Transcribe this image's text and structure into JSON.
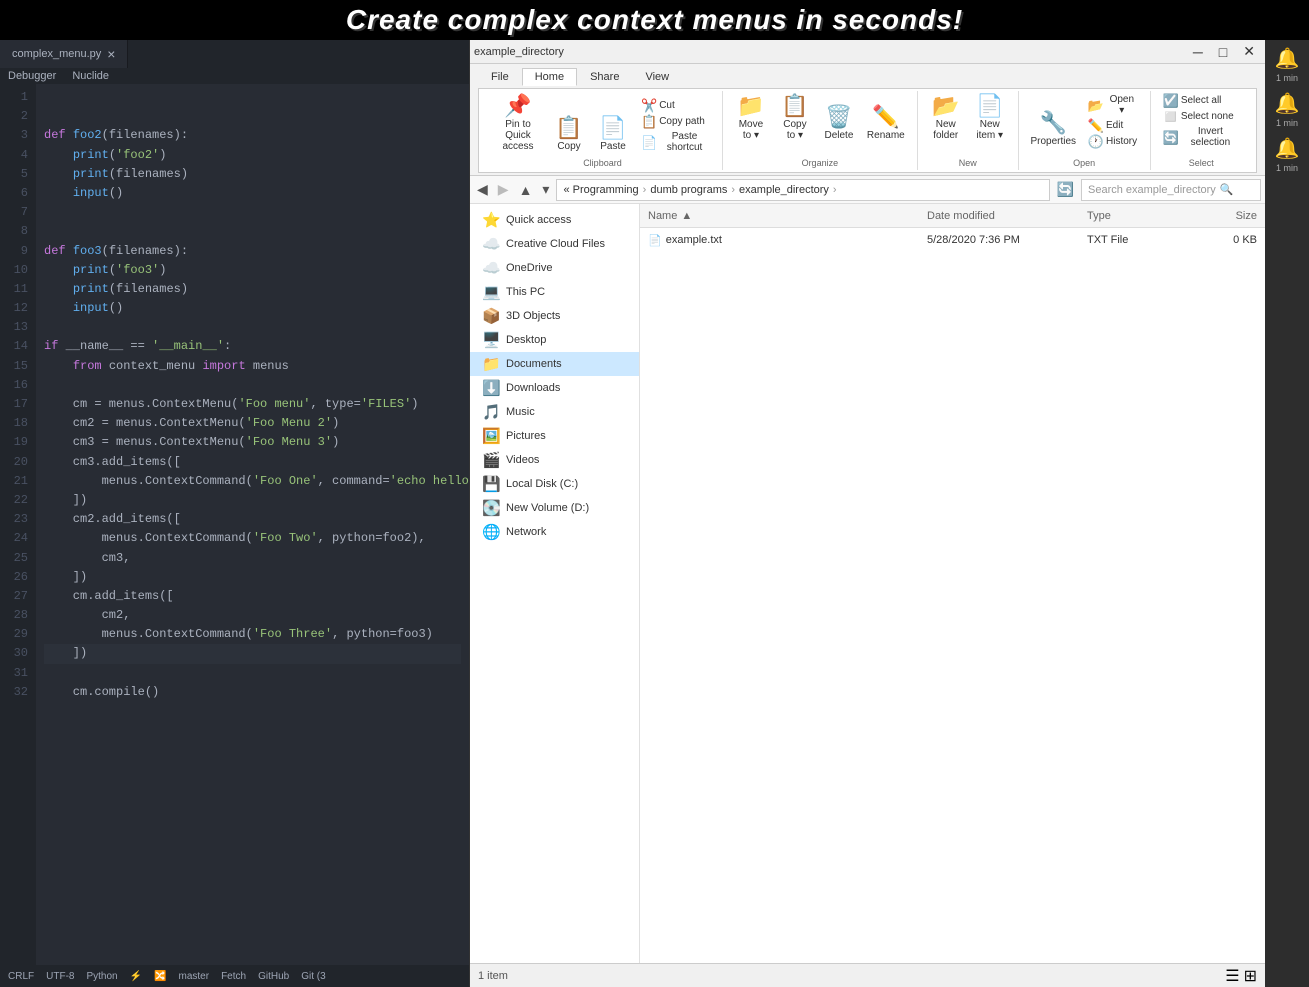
{
  "banner": {
    "text": "Create complex context menus in seconds!"
  },
  "editor": {
    "tab_name": "complex_menu.py",
    "menu_items": [
      "Debugger",
      "Nuclide"
    ],
    "code_lines": [
      {
        "num": 1,
        "text": ""
      },
      {
        "num": 2,
        "text": ""
      },
      {
        "num": 3,
        "text": "def foo2(filenames):"
      },
      {
        "num": 4,
        "text": "    print('foo2')"
      },
      {
        "num": 5,
        "text": "    print(filenames)"
      },
      {
        "num": 6,
        "text": "    input()"
      },
      {
        "num": 7,
        "text": ""
      },
      {
        "num": 8,
        "text": ""
      },
      {
        "num": 9,
        "text": "def foo3(filenames):"
      },
      {
        "num": 10,
        "text": "    print('foo3')"
      },
      {
        "num": 11,
        "text": "    print(filenames)"
      },
      {
        "num": 12,
        "text": "    input()"
      },
      {
        "num": 13,
        "text": ""
      },
      {
        "num": 14,
        "text": "if __name__ == '__main__':"
      },
      {
        "num": 15,
        "text": "    from context_menu import menus"
      },
      {
        "num": 16,
        "text": ""
      },
      {
        "num": 17,
        "text": "    cm = menus.ContextMenu('Foo menu', type='FILES')"
      },
      {
        "num": 18,
        "text": "    cm2 = menus.ContextMenu('Foo Menu 2')"
      },
      {
        "num": 19,
        "text": "    cm3 = menus.ContextMenu('Foo Menu 3')"
      },
      {
        "num": 20,
        "text": "    cm3.add_items(["
      },
      {
        "num": 21,
        "text": "        menus.ContextCommand('Foo One', command='echo hello > example.txt'),"
      },
      {
        "num": 22,
        "text": "    ])"
      },
      {
        "num": 23,
        "text": "    cm2.add_items(["
      },
      {
        "num": 24,
        "text": "        menus.ContextCommand('Foo Two', python=foo2),"
      },
      {
        "num": 25,
        "text": "        cm3,"
      },
      {
        "num": 26,
        "text": "    ])"
      },
      {
        "num": 27,
        "text": "    cm.add_items(["
      },
      {
        "num": 28,
        "text": "        cm2,"
      },
      {
        "num": 29,
        "text": "        menus.ContextCommand('Foo Three', python=foo3)"
      },
      {
        "num": 30,
        "text": "    ])"
      },
      {
        "num": 31,
        "text": "    cm.compile()"
      },
      {
        "num": 32,
        "text": ""
      }
    ],
    "statusbar": {
      "crlf": "CRLF",
      "encoding": "UTF-8",
      "language": "Python",
      "branch": "master",
      "fetch": "Fetch",
      "github": "GitHub",
      "git": "Git (3"
    }
  },
  "explorer": {
    "title": "example_directory",
    "ribbon": {
      "tabs": [
        "File",
        "Home",
        "Share",
        "View"
      ],
      "active_tab": "Home",
      "groups": [
        {
          "name": "Clipboard",
          "items": [
            {
              "label": "Pin to Quick\naccess",
              "icon": "📌",
              "type": "large"
            },
            {
              "label": "Copy",
              "icon": "📋",
              "type": "large"
            },
            {
              "label": "Paste",
              "icon": "📄",
              "type": "large"
            },
            {
              "label": "Cut",
              "icon": "✂️",
              "type": "small"
            },
            {
              "label": "Copy path",
              "icon": "📋",
              "type": "small"
            },
            {
              "label": "Paste shortcut",
              "icon": "📄",
              "type": "small"
            }
          ]
        },
        {
          "name": "Organize",
          "items": [
            {
              "label": "Move to",
              "icon": "📁",
              "type": "large"
            },
            {
              "label": "Copy to",
              "icon": "📋",
              "type": "large"
            },
            {
              "label": "Delete",
              "icon": "🗑️",
              "type": "large"
            },
            {
              "label": "Rename",
              "icon": "✏️",
              "type": "large"
            }
          ]
        },
        {
          "name": "New",
          "items": [
            {
              "label": "New\nfolder",
              "icon": "📂",
              "type": "large"
            },
            {
              "label": "New\nitem",
              "icon": "📄",
              "type": "large"
            }
          ]
        },
        {
          "name": "Open",
          "items": [
            {
              "label": "Properties",
              "icon": "🔧",
              "type": "large"
            },
            {
              "label": "Open",
              "icon": "📂",
              "type": "small",
              "has_arrow": true
            },
            {
              "label": "Edit",
              "icon": "✏️",
              "type": "small"
            },
            {
              "label": "History",
              "icon": "🕐",
              "type": "small"
            }
          ]
        },
        {
          "name": "Select",
          "items": [
            {
              "label": "Select all",
              "icon": "☑️",
              "type": "small"
            },
            {
              "label": "Select none",
              "icon": "◻️",
              "type": "small"
            },
            {
              "label": "Invert selection",
              "icon": "🔄",
              "type": "small"
            }
          ]
        }
      ]
    },
    "address": {
      "breadcrumbs": [
        "« Programming",
        "dumb programs",
        "example_directory"
      ],
      "search_placeholder": "Search example_directory"
    },
    "sidebar": [
      {
        "label": "Quick access",
        "icon": "⭐",
        "type": "header"
      },
      {
        "label": "Creative Cloud Files",
        "icon": "☁️"
      },
      {
        "label": "OneDrive",
        "icon": "☁️"
      },
      {
        "label": "This PC",
        "icon": "💻"
      },
      {
        "label": "3D Objects",
        "icon": "📦"
      },
      {
        "label": "Desktop",
        "icon": "🖥️"
      },
      {
        "label": "Documents",
        "icon": "📁",
        "active": true
      },
      {
        "label": "Downloads",
        "icon": "⬇️"
      },
      {
        "label": "Music",
        "icon": "🎵"
      },
      {
        "label": "Pictures",
        "icon": "🖼️"
      },
      {
        "label": "Videos",
        "icon": "🎬"
      },
      {
        "label": "Local Disk (C:)",
        "icon": "💾"
      },
      {
        "label": "New Volume (D:)",
        "icon": "💽"
      },
      {
        "label": "Network",
        "icon": "🌐"
      }
    ],
    "files": [
      {
        "name": "example.txt",
        "icon": "📄",
        "date_modified": "5/28/2020 7:36 PM",
        "type": "TXT File",
        "size": "0 KB"
      }
    ],
    "columns": {
      "name": "Name",
      "date_modified": "Date modified",
      "type": "Type",
      "size": "Size"
    },
    "status": {
      "count": "1 item"
    }
  },
  "notifications": [
    {
      "time": "1 min",
      "icon": "🔔"
    },
    {
      "time": "1 min",
      "icon": "🔔"
    },
    {
      "time": "1 min",
      "icon": "🔔"
    }
  ]
}
